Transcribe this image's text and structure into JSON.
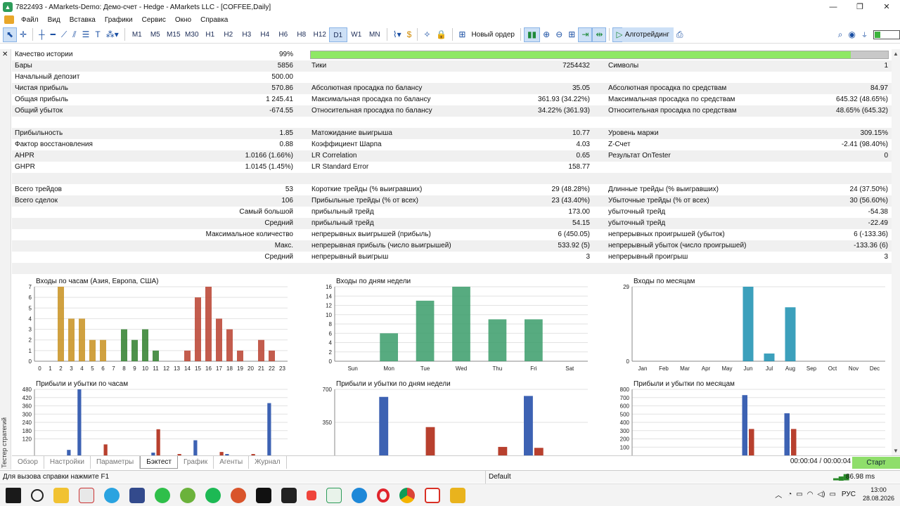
{
  "window": {
    "title": "7822493 - AMarkets-Demo: Демо-счет - Hedge - AMarkets LLC - [COFFEE,Daily]"
  },
  "menu": [
    "Файл",
    "Вид",
    "Вставка",
    "Графики",
    "Сервис",
    "Окно",
    "Справка"
  ],
  "toolbar": {
    "timeframes": [
      "M1",
      "M5",
      "M15",
      "M30",
      "H1",
      "H2",
      "H3",
      "H4",
      "H6",
      "H8",
      "H12",
      "D1",
      "W1",
      "MN"
    ],
    "selected_tf": "D1",
    "new_order": "Новый ордер",
    "algotrading": "Алготрейдинг"
  },
  "side": {
    "vertical_label": "Тестер стратегий"
  },
  "stats": {
    "history_quality_label": "Качество истории",
    "history_quality_value": "99%",
    "history_quality_fill": 0.935,
    "rows": [
      {
        "l1": "Бары",
        "v1": "5856",
        "l2": "Тики",
        "v2": "7254432",
        "l3": "Символы",
        "v3": "1"
      },
      {
        "l1": "Начальный депозит",
        "v1": "500.00",
        "l2": "",
        "v2": "",
        "l3": "",
        "v3": ""
      },
      {
        "l1": "Чистая прибыль",
        "v1": "570.86",
        "l2": "Абсолютная просадка по балансу",
        "v2": "35.05",
        "l3": "Абсолютная просадка по средствам",
        "v3": "84.97"
      },
      {
        "l1": "Общая прибыль",
        "v1": "1 245.41",
        "l2": "Максимальная просадка по балансу",
        "v2": "361.93 (34.22%)",
        "l3": "Максимальная просадка по средствам",
        "v3": "645.32 (48.65%)"
      },
      {
        "l1": "Общий убыток",
        "v1": "-674.55",
        "l2": "Относительная просадка по балансу",
        "v2": "34.22% (361.93)",
        "l3": "Относительная просадка по средствам",
        "v3": "48.65% (645.32)"
      },
      {
        "l1": "",
        "v1": "",
        "l2": "",
        "v2": "",
        "l3": "",
        "v3": ""
      },
      {
        "l1": "Прибыльность",
        "v1": "1.85",
        "l2": "Матожидание выигрыша",
        "v2": "10.77",
        "l3": "Уровень маржи",
        "v3": "309.15%"
      },
      {
        "l1": "Фактор восстановления",
        "v1": "0.88",
        "l2": "Коэффициент Шарпа",
        "v2": "4.03",
        "l3": "Z-Счет",
        "v3": "-2.41 (98.40%)"
      },
      {
        "l1": "AHPR",
        "v1": "1.0166 (1.66%)",
        "l2": "LR Correlation",
        "v2": "0.65",
        "l3": "Результат OnTester",
        "v3": "0"
      },
      {
        "l1": "GHPR",
        "v1": "1.0145 (1.45%)",
        "l2": "LR Standard Error",
        "v2": "158.77",
        "l3": "",
        "v3": ""
      },
      {
        "l1": "",
        "v1": "",
        "l2": "",
        "v2": "",
        "l3": "",
        "v3": ""
      },
      {
        "l1": "Всего трейдов",
        "v1": "53",
        "l2": "Короткие трейды (% выигравших)",
        "v2": "29 (48.28%)",
        "l3": "Длинные трейды (% выигравших)",
        "v3": "24 (37.50%)"
      },
      {
        "l1": "Всего сделок",
        "v1": "106",
        "l2": "Прибыльные трейды (% от всех)",
        "v2": "23 (43.40%)",
        "l3": "Убыточные трейды (% от всех)",
        "v3": "30 (56.60%)"
      }
    ],
    "rows_right_label": [
      {
        "l1": "Самый большой",
        "l2": "прибыльный трейд",
        "v2": "173.00",
        "l3": "убыточный трейд",
        "v3": "-54.38"
      },
      {
        "l1": "Средний",
        "l2": "прибыльный трейд",
        "v2": "54.15",
        "l3": "убыточный трейд",
        "v3": "-22.49"
      },
      {
        "l1": "Максимальное количество",
        "l2": "непрерывных выигрышей (прибыль)",
        "v2": "6 (450.05)",
        "l3": "непрерывных проигрышей (убыток)",
        "v3": "6 (-133.36)"
      },
      {
        "l1": "Макс.",
        "l2": "непрерывная прибыль (число выигрышей)",
        "v2": "533.92 (5)",
        "l3": "непрерывный убыток (число проигрышей)",
        "v3": "-133.36 (6)"
      },
      {
        "l1": "Средний",
        "l2": "непрерывный выигрыш",
        "v2": "3",
        "l3": "непрерывный проигрыш",
        "v3": "3"
      }
    ]
  },
  "chart_data": [
    {
      "type": "bar",
      "title": "Входы по часам (Азия, Европа, США)",
      "categories": [
        "0",
        "1",
        "2",
        "3",
        "4",
        "5",
        "6",
        "7",
        "8",
        "9",
        "10",
        "11",
        "12",
        "13",
        "14",
        "15",
        "16",
        "17",
        "18",
        "19",
        "20",
        "21",
        "22",
        "23"
      ],
      "values": [
        0,
        0,
        7,
        4,
        4,
        2,
        2,
        0,
        3,
        2,
        3,
        1,
        0,
        0,
        1,
        6,
        7,
        4,
        3,
        1,
        0,
        2,
        1,
        0
      ],
      "ylim": [
        0,
        7
      ],
      "yticks": [
        0,
        1,
        2,
        3,
        4,
        5,
        6,
        7
      ]
    },
    {
      "type": "bar",
      "title": "Входы по дням недели",
      "categories": [
        "Sun",
        "Mon",
        "Tue",
        "Wed",
        "Thu",
        "Fri",
        "Sat"
      ],
      "values": [
        0,
        6,
        13,
        16,
        9,
        9,
        0
      ],
      "ylim": [
        0,
        16
      ],
      "yticks": [
        0,
        2,
        4,
        6,
        8,
        10,
        12,
        14,
        16
      ]
    },
    {
      "type": "bar",
      "title": "Входы по месяцам",
      "categories": [
        "Jan",
        "Feb",
        "Mar",
        "Apr",
        "May",
        "Jun",
        "Jul",
        "Aug",
        "Sep",
        "Oct",
        "Nov",
        "Dec"
      ],
      "values": [
        0,
        0,
        0,
        0,
        0,
        29,
        3,
        21,
        0,
        0,
        0,
        0
      ],
      "ylim": [
        0,
        29
      ],
      "yticks": [
        0,
        29
      ]
    },
    {
      "type": "bar",
      "title": "Прибыли и убытки по часам",
      "categories": [
        "0",
        "1",
        "2",
        "3",
        "4",
        "5",
        "6",
        "7",
        "8",
        "9",
        "10",
        "11",
        "12",
        "13",
        "14",
        "15",
        "16",
        "17",
        "18",
        "19",
        "20",
        "21",
        "22",
        "23"
      ],
      "series": [
        {
          "values": [
            0,
            0,
            0,
            0,
            0,
            0,
            0,
            0,
            0,
            0,
            0,
            0,
            0,
            0,
            0,
            0,
            0,
            0,
            0,
            0,
            0,
            0,
            0,
            0
          ]
        }
      ],
      "profits": [
        0,
        0,
        0,
        40,
        480,
        0,
        0,
        0,
        0,
        0,
        0,
        20,
        0,
        0,
        0,
        110,
        0,
        0,
        10,
        0,
        0,
        0,
        380,
        0
      ],
      "losses": [
        0,
        0,
        0,
        0,
        0,
        0,
        80,
        0,
        0,
        0,
        0,
        190,
        0,
        10,
        0,
        0,
        0,
        25,
        0,
        0,
        10,
        0,
        0,
        0
      ],
      "ylim": [
        0,
        480
      ],
      "yticks": [
        120,
        180,
        240,
        300,
        360,
        420,
        480
      ]
    },
    {
      "type": "bar",
      "title": "Прибыли и убытки по дням недели",
      "categories": [
        "Sun",
        "Mon",
        "Tue",
        "Wed",
        "Thu",
        "Fri",
        "Sat"
      ],
      "profits": [
        0,
        620,
        0,
        0,
        0,
        630,
        0
      ],
      "losses": [
        0,
        0,
        300,
        0,
        90,
        80,
        0
      ],
      "ylim": [
        0,
        700
      ],
      "yticks": [
        350,
        700
      ]
    },
    {
      "type": "bar",
      "title": "Прибыли и убытки по месяцам",
      "categories": [
        "Jan",
        "Feb",
        "Mar",
        "Apr",
        "May",
        "Jun",
        "Jul",
        "Aug",
        "Sep",
        "Oct",
        "Nov",
        "Dec"
      ],
      "profits": [
        0,
        0,
        0,
        0,
        0,
        730,
        0,
        510,
        0,
        0,
        0,
        0
      ],
      "losses": [
        0,
        0,
        0,
        0,
        0,
        320,
        0,
        320,
        0,
        0,
        0,
        0
      ],
      "ylim": [
        0,
        800
      ],
      "yticks": [
        100,
        200,
        300,
        400,
        500,
        600,
        700,
        800
      ]
    }
  ],
  "bottom_tabs": [
    "Обзор",
    "Настройки",
    "Параметры",
    "Бэктест",
    "График",
    "Агенты",
    "Журнал"
  ],
  "active_tab": "Бэктест",
  "timer": "00:00:04 / 00:00:04",
  "start_label": "Старт",
  "status": {
    "help": "Для вызова справки нажмите F1",
    "profile": "Default",
    "ping": "86.98 ms"
  },
  "tray": {
    "lang": "РУС",
    "time": "13:00",
    "date": "28.08.2026"
  },
  "colors": {
    "hours_asia": "#c8911e",
    "hours_europe": "#2f7f2c",
    "hours_usa": "#b8402e",
    "weekday": "#3a9c6a",
    "month": "#1a8fb0",
    "profit": "#3d62b3",
    "loss": "#b8402e",
    "pbar": "#8fe865"
  }
}
